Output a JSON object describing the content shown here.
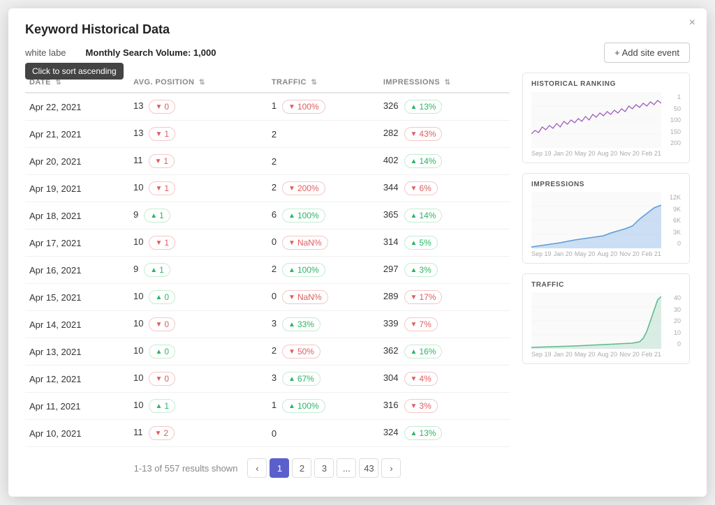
{
  "modal": {
    "title": "Keyword Historical Data",
    "close_label": "×"
  },
  "header": {
    "keyword": "white labe",
    "tooltip": "Click to sort ascending",
    "monthly_search_label": "Monthly Search Volume:",
    "monthly_search_value": "1,000",
    "add_site_label": "+ Add site event"
  },
  "table": {
    "columns": [
      {
        "id": "date",
        "label": "DATE"
      },
      {
        "id": "avg_position",
        "label": "AVG. Position"
      },
      {
        "id": "traffic",
        "label": "TRAFFIC"
      },
      {
        "id": "impressions",
        "label": "IMPRESSIONS"
      }
    ],
    "rows": [
      {
        "date": "Apr 22, 2021",
        "avg_pos": "13",
        "pos_delta": "0",
        "pos_dir": "down",
        "traffic": "1",
        "traffic_delta": "100%",
        "traffic_dir": "down",
        "impressions": "326",
        "imp_delta": "13%",
        "imp_dir": "up"
      },
      {
        "date": "Apr 21, 2021",
        "avg_pos": "13",
        "pos_delta": "1",
        "pos_dir": "down",
        "traffic": "2",
        "traffic_delta": "",
        "traffic_dir": "none",
        "impressions": "282",
        "imp_delta": "43%",
        "imp_dir": "down"
      },
      {
        "date": "Apr 20, 2021",
        "avg_pos": "11",
        "pos_delta": "1",
        "pos_dir": "down",
        "traffic": "2",
        "traffic_delta": "",
        "traffic_dir": "none",
        "impressions": "402",
        "imp_delta": "14%",
        "imp_dir": "up"
      },
      {
        "date": "Apr 19, 2021",
        "avg_pos": "10",
        "pos_delta": "1",
        "pos_dir": "down",
        "traffic": "2",
        "traffic_delta": "200%",
        "traffic_dir": "down",
        "impressions": "344",
        "imp_delta": "6%",
        "imp_dir": "down"
      },
      {
        "date": "Apr 18, 2021",
        "avg_pos": "9",
        "pos_delta": "1",
        "pos_dir": "up",
        "traffic": "6",
        "traffic_delta": "100%",
        "traffic_dir": "up",
        "impressions": "365",
        "imp_delta": "14%",
        "imp_dir": "up"
      },
      {
        "date": "Apr 17, 2021",
        "avg_pos": "10",
        "pos_delta": "1",
        "pos_dir": "down",
        "traffic": "0",
        "traffic_delta": "NaN%",
        "traffic_dir": "down",
        "impressions": "314",
        "imp_delta": "5%",
        "imp_dir": "up"
      },
      {
        "date": "Apr 16, 2021",
        "avg_pos": "9",
        "pos_delta": "1",
        "pos_dir": "up",
        "traffic": "2",
        "traffic_delta": "100%",
        "traffic_dir": "up",
        "impressions": "297",
        "imp_delta": "3%",
        "imp_dir": "up"
      },
      {
        "date": "Apr 15, 2021",
        "avg_pos": "10",
        "pos_delta": "0",
        "pos_dir": "up",
        "traffic": "0",
        "traffic_delta": "NaN%",
        "traffic_dir": "down",
        "impressions": "289",
        "imp_delta": "17%",
        "imp_dir": "down"
      },
      {
        "date": "Apr 14, 2021",
        "avg_pos": "10",
        "pos_delta": "0",
        "pos_dir": "down",
        "traffic": "3",
        "traffic_delta": "33%",
        "traffic_dir": "up",
        "impressions": "339",
        "imp_delta": "7%",
        "imp_dir": "down"
      },
      {
        "date": "Apr 13, 2021",
        "avg_pos": "10",
        "pos_delta": "0",
        "pos_dir": "up",
        "traffic": "2",
        "traffic_delta": "50%",
        "traffic_dir": "down",
        "impressions": "362",
        "imp_delta": "16%",
        "imp_dir": "up"
      },
      {
        "date": "Apr 12, 2021",
        "avg_pos": "10",
        "pos_delta": "0",
        "pos_dir": "down",
        "traffic": "3",
        "traffic_delta": "67%",
        "traffic_dir": "up",
        "impressions": "304",
        "imp_delta": "4%",
        "imp_dir": "down"
      },
      {
        "date": "Apr 11, 2021",
        "avg_pos": "10",
        "pos_delta": "1",
        "pos_dir": "up",
        "traffic": "1",
        "traffic_delta": "100%",
        "traffic_dir": "up",
        "impressions": "316",
        "imp_delta": "3%",
        "imp_dir": "down"
      },
      {
        "date": "Apr 10, 2021",
        "avg_pos": "11",
        "pos_delta": "2",
        "pos_dir": "down",
        "traffic": "0",
        "traffic_delta": "",
        "traffic_dir": "none",
        "impressions": "324",
        "imp_delta": "13%",
        "imp_dir": "up"
      }
    ]
  },
  "pagination": {
    "info": "1-13 of 557 results shown",
    "pages": [
      "1",
      "2",
      "3",
      "...",
      "43"
    ],
    "current": "1",
    "prev": "‹",
    "next": "›"
  },
  "charts": {
    "historical_ranking": {
      "title": "HISTORICAL RANKING",
      "y_labels": [
        "1",
        "50",
        "100",
        "150",
        "200"
      ],
      "x_labels": [
        "Sep 19",
        "Jan 20",
        "May 20",
        "Aug 20",
        "Nov 20",
        "Feb 21"
      ]
    },
    "impressions": {
      "title": "IMPRESSIONS",
      "y_labels": [
        "12K",
        "9K",
        "6K",
        "3K",
        "0"
      ],
      "x_labels": [
        "Sep 19",
        "Jan 20",
        "May 20",
        "Aug 20",
        "Nov 20",
        "Feb 21"
      ]
    },
    "traffic": {
      "title": "TRAFFIC",
      "y_labels": [
        "40",
        "30",
        "20",
        "10",
        "0"
      ],
      "x_labels": [
        "Sep 19",
        "Jan 20",
        "May 20",
        "Aug 20",
        "Nov 20",
        "Feb 21"
      ]
    }
  }
}
